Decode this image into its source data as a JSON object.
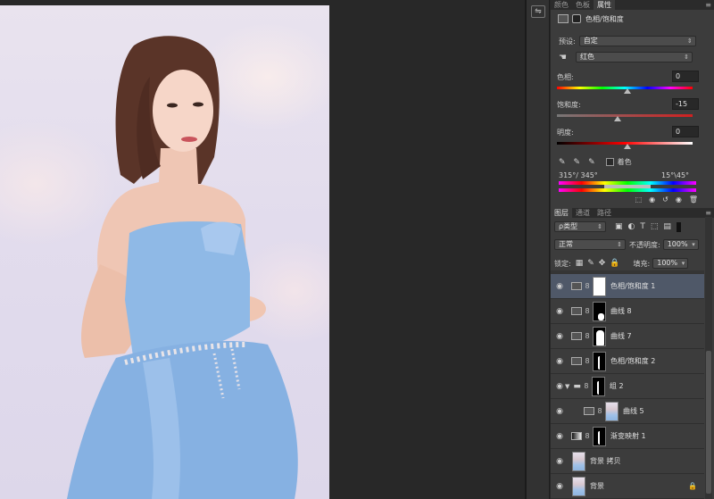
{
  "top_tabs": [
    "颜色",
    "色板",
    "属性"
  ],
  "properties": {
    "title": "色相/饱和度",
    "preset_label": "预设:",
    "preset_value": "自定",
    "channel_value": "红色",
    "hue_label": "色相:",
    "hue_value": "0",
    "sat_label": "饱和度:",
    "sat_value": "-15",
    "light_label": "明度:",
    "light_value": "0",
    "colorize_label": "着色",
    "range_left": "315°/ 345°",
    "range_right": "15°\\45°"
  },
  "layers_tabs": [
    "图层",
    "通道",
    "路径"
  ],
  "layers_panel": {
    "filter_kind": "ρ类型",
    "blend_mode": "正常",
    "opacity_label": "不透明度:",
    "opacity_value": "100%",
    "lock_label": "锁定:",
    "fill_label": "填充:",
    "fill_value": "100%"
  },
  "layers": [
    {
      "name": "色相/饱和度 1",
      "type": "hue",
      "selected": true,
      "mask": "white"
    },
    {
      "name": "曲线 8",
      "type": "curves",
      "mask": "black-small"
    },
    {
      "name": "曲线 7",
      "type": "curves",
      "mask": "silhouette"
    },
    {
      "name": "色相/饱和度 2",
      "type": "hue",
      "mask": "stroke"
    },
    {
      "name": "组 2",
      "type": "group",
      "mask": "stroke"
    },
    {
      "name": "曲线 5",
      "type": "curves",
      "mask": "photo",
      "indent": true
    },
    {
      "name": "渐变映射 1",
      "type": "gradient",
      "mask": "stroke"
    },
    {
      "name": "背景 拷贝",
      "type": "photo"
    },
    {
      "name": "背景",
      "type": "photo",
      "locked": true
    }
  ]
}
